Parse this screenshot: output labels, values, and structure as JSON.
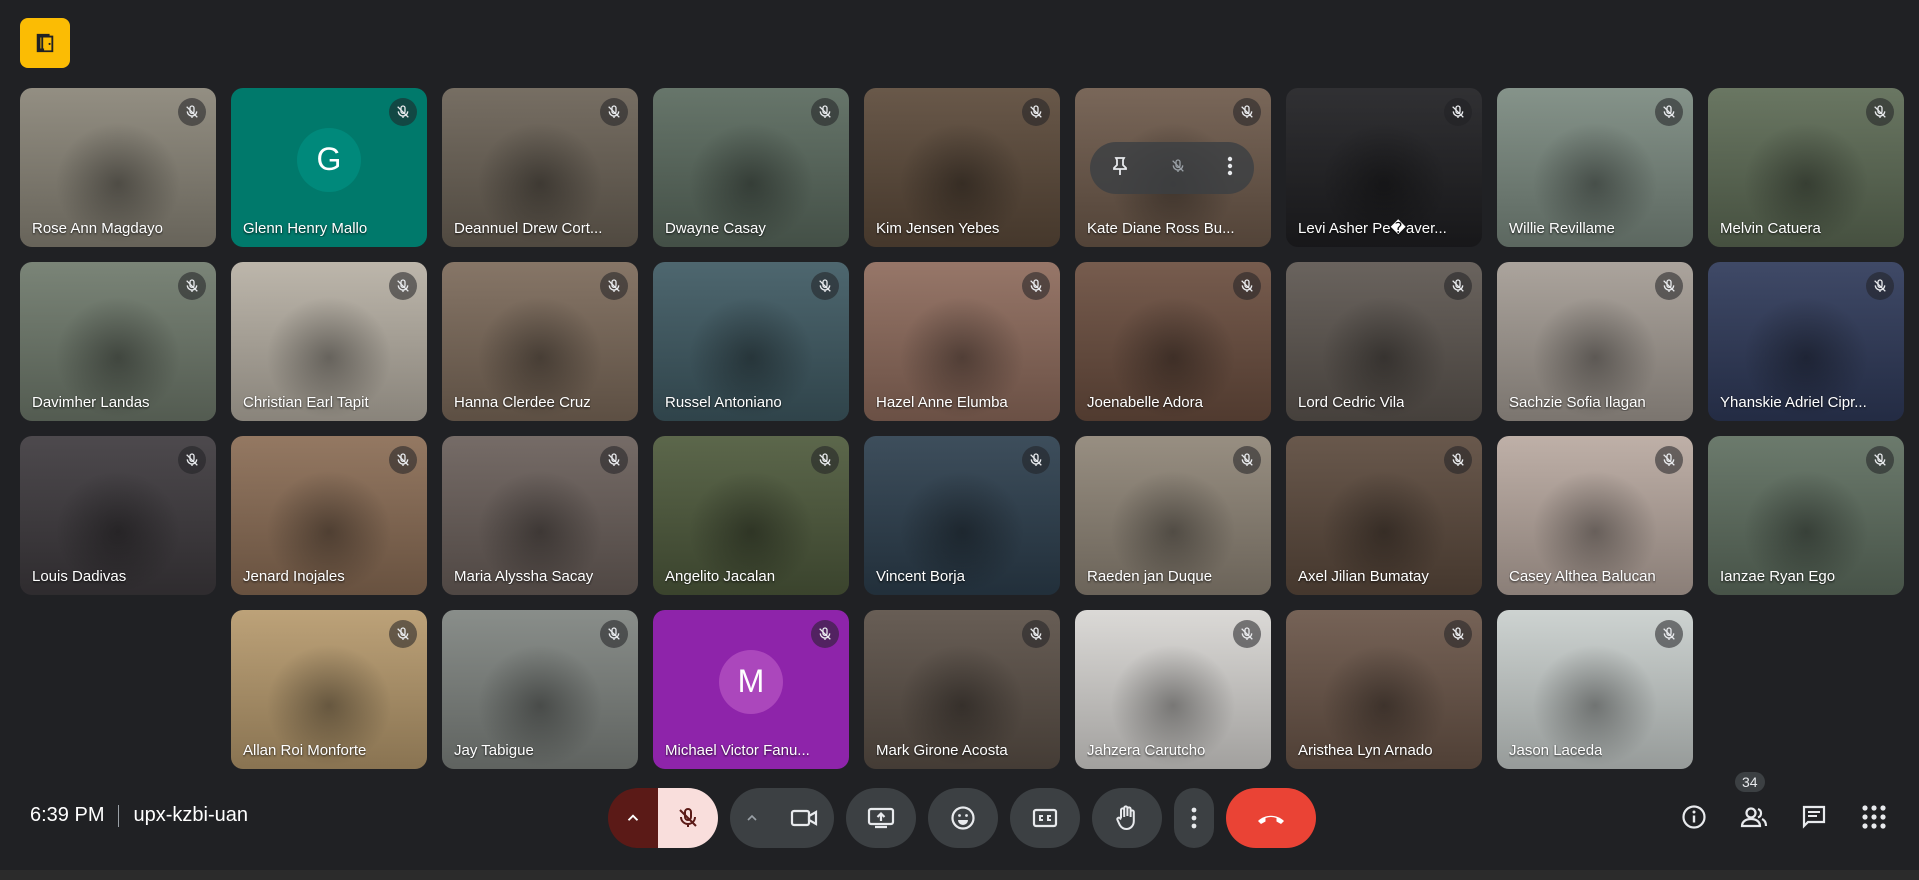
{
  "meeting": {
    "time": "6:39 PM",
    "code": "upx-kzbi-uan",
    "participant_count": "34"
  },
  "colors": {
    "background": "#202124",
    "tile": "#3c4043",
    "accent_yellow": "#fbbc04",
    "hangup_red": "#ea4335",
    "mic_off_red": "#5b1a17",
    "mic_off_pink": "#f9dedc"
  },
  "rows": [
    [
      {
        "name": "Rose Ann Magdayo",
        "bg": "#8a8578"
      },
      {
        "name": "Glenn Henry Mallo",
        "bg": "#00796b",
        "avatar": "G",
        "avatar_bg": "#00897b"
      },
      {
        "name": "Deannuel Drew Cort...",
        "bg": "#6b6256"
      },
      {
        "name": "Dwayne Casay",
        "bg": "#5a6a5e"
      },
      {
        "name": "Kim Jensen Yebes",
        "bg": "#5c4a3a"
      },
      {
        "name": "Kate Diane Ross Bu...",
        "bg": "#6e5a4b",
        "overlay": true
      },
      {
        "name": "Levi Asher Pe�aver...",
        "bg": "#1f1f22"
      },
      {
        "name": "Willie Revillame",
        "bg": "#7b8a80"
      },
      {
        "name": "Melvin Catuera",
        "bg": "#5d6b55"
      }
    ],
    [
      {
        "name": "Davimher Landas",
        "bg": "#6f7a6c"
      },
      {
        "name": "Christian Earl Tapit",
        "bg": "#b7b0a4"
      },
      {
        "name": "Hanna Clerdee Cruz",
        "bg": "#7c6a5a"
      },
      {
        "name": "Russel Antoniano",
        "bg": "#3f5a63"
      },
      {
        "name": "Hazel Anne Elumba",
        "bg": "#8e6b5c"
      },
      {
        "name": "Joenabelle Adora",
        "bg": "#6b4e3f"
      },
      {
        "name": "Lord Cedric Vila",
        "bg": "#5d5650"
      },
      {
        "name": "Sachzie Sofia Ilagan",
        "bg": "#a49c94"
      },
      {
        "name": "Yhanskie Adriel Cipr...",
        "bg": "#2f3a5a"
      }
    ],
    [
      {
        "name": "Louis Dadivas",
        "bg": "#3e3a3e"
      },
      {
        "name": "Jenard Inojales",
        "bg": "#8b6d55"
      },
      {
        "name": "Maria Alyssha Sacay",
        "bg": "#6a5f5a"
      },
      {
        "name": "Angelito Jacalan",
        "bg": "#4e5a3c"
      },
      {
        "name": "Vincent Borja",
        "bg": "#2d3f4e"
      },
      {
        "name": "Raeden jan Duque",
        "bg": "#8f8577"
      },
      {
        "name": "Axel Jilian Bumatay",
        "bg": "#5c4a3d"
      },
      {
        "name": "Casey Althea Balucan",
        "bg": "#b9a9a0"
      },
      {
        "name": "Ianzae Ryan Ego",
        "bg": "#5f6f60"
      }
    ],
    [
      {
        "name": "Allan Roi Monforte",
        "bg": "#b79a6d"
      },
      {
        "name": "Jay Tabigue",
        "bg": "#7f8480"
      },
      {
        "name": "Michael Victor Fanu...",
        "bg": "#8e24aa",
        "avatar": "M",
        "avatar_bg": "#ab47bc"
      },
      {
        "name": "Mark Girone Acosta",
        "bg": "#5b5047"
      },
      {
        "name": "Jahzera Carutcho",
        "bg": "#d8d6d3"
      },
      {
        "name": "Aristhea Lyn Arnado",
        "bg": "#6a5548"
      },
      {
        "name": "Jason Laceda",
        "bg": "#c9cfcd"
      }
    ]
  ],
  "icons": {
    "mic_off": "mic-off-icon",
    "pin": "pin-icon",
    "more": "more-vert-icon"
  }
}
